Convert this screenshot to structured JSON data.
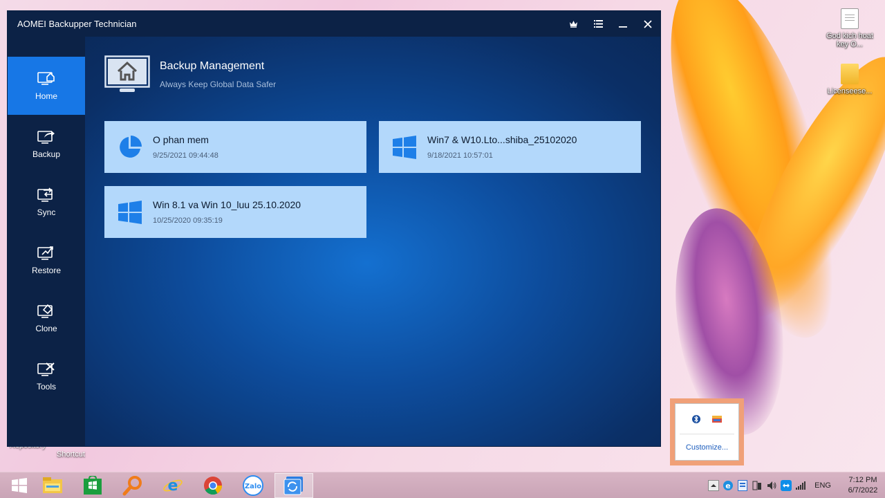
{
  "window": {
    "title": "AOMEI Backupper Technician"
  },
  "sidebar": {
    "items": [
      {
        "label": "Home",
        "icon": "home-monitor-icon",
        "active": true
      },
      {
        "label": "Backup",
        "icon": "backup-monitor-icon"
      },
      {
        "label": "Sync",
        "icon": "sync-monitor-icon"
      },
      {
        "label": "Restore",
        "icon": "restore-monitor-icon"
      },
      {
        "label": "Clone",
        "icon": "clone-monitor-icon"
      },
      {
        "label": "Tools",
        "icon": "tools-monitor-icon"
      }
    ]
  },
  "header": {
    "title": "Backup Management",
    "subtitle": "Always Keep Global Data Safer"
  },
  "backups": [
    {
      "name": "O phan mem",
      "date": "9/25/2021 09:44:48",
      "icon": "pie-chart-icon"
    },
    {
      "name": "Win7 & W10.Lto...shiba_25102020",
      "date": "9/18/2021 10:57:01",
      "icon": "windows-logo-icon"
    },
    {
      "name": "Win 8.1 va Win 10_luu 25.10.2020",
      "date": "10/25/2020 09:35:19",
      "icon": "windows-logo-icon"
    }
  ],
  "desktop": {
    "icons": [
      {
        "label": "God kich hoat key O...",
        "icon": "document-icon"
      },
      {
        "label": "Licenseese...",
        "icon": "folder-icon"
      }
    ],
    "bottom_labels": [
      "Repository",
      "Shortcut",
      "...",
      "..."
    ]
  },
  "tray_popup": {
    "customize_label": "Customize..."
  },
  "taskbar": {
    "apps": [
      "start-icon",
      "file-explorer-icon",
      "store-icon",
      "search-icon",
      "internet-explorer-icon",
      "chrome-icon",
      "zalo-icon",
      "aomei-backupper-icon"
    ],
    "zalo_label": "Zalo",
    "language": "ENG",
    "time": "7:12 PM",
    "date": "6/7/2022"
  },
  "colors": {
    "accent": "#1777e6",
    "card_bg": "#b3d8fb",
    "titlebar": "#0c2246"
  }
}
